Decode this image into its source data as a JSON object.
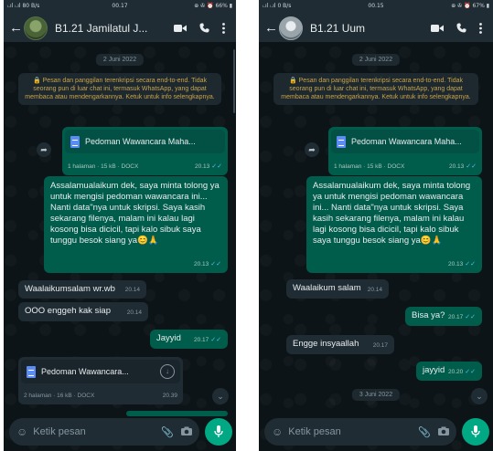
{
  "left": {
    "status": {
      "left": "ᵢ.ıl ᵢ.ıl 80 B/s",
      "time": "00.17",
      "right": "⊕ ✇ ⏰ 66% ▮"
    },
    "contact_name": "B1.21 Jamilatul J...",
    "date_chip": "2 Juni 2022",
    "encryption_notice": "🔒 Pesan dan panggilan terenkripsi secara end-to-end. Tidak seorang pun di luar chat ini, termasuk WhatsApp, yang dapat membaca atau mendengarkannya. Ketuk untuk info selengkapnya.",
    "doc_out": {
      "title": "Pedoman Wawancara Maha...",
      "meta": "1 halaman · 15 kB · DOCX",
      "time": "20.13"
    },
    "long_msg": {
      "text": "Assalamualaikum dek, saya minta tolong ya untuk mengisi pedoman wawancara ini... Nanti data\"nya untuk skripsi. Saya kasih sekarang filenya, malam ini kalau lagi kosong bisa dicicil, tapi kalo sibuk saya tunggu besok siang ya😊🙏",
      "time": "20.13"
    },
    "in_msgs": [
      {
        "text": "Waalaikumsalam wr.wb",
        "time": "20.14"
      },
      {
        "text": "OOO enggeh kak siap",
        "time": "20.14"
      }
    ],
    "out_short": {
      "text": "Jayyid",
      "time": "20.17"
    },
    "doc_in": {
      "title": "Pedoman Wawancara...",
      "meta": "2 halaman · 16 kB · DOCX",
      "time": "20.39"
    },
    "composer_placeholder": "Ketik pesan"
  },
  "right": {
    "status": {
      "left": "ᵢ.ıl ᵢ.ıl 0 B/s",
      "time": "00.15",
      "right": "⊕ ✇ ⏰ 67% ▮"
    },
    "contact_name": "B1.21 Uum",
    "date_chip": "2 Juni 2022",
    "encryption_notice": "🔒 Pesan dan panggilan terenkripsi secara end-to-end. Tidak seorang pun di luar chat ini, termasuk WhatsApp, yang dapat membaca atau mendengarkannya. Ketuk untuk info selengkapnya.",
    "doc_out": {
      "title": "Pedoman Wawancara Maha...",
      "meta": "1 halaman · 15 kB · DOCX",
      "time": "20.13"
    },
    "long_msg": {
      "text": "Assalamualaikum dek, saya minta tolong ya untuk mengisi pedoman wawancara ini... Nanti data\"nya untuk skripsi. Saya kasih sekarang filenya, malam ini kalau lagi kosong bisa dicicil, tapi kalo sibuk saya tunggu besok siang ya😊🙏",
      "time": "20.13"
    },
    "in_msg_1": {
      "text": "Waalaikum salam",
      "time": "20.14"
    },
    "out_msg_1": {
      "text": "Bisa ya?",
      "time": "20.17"
    },
    "in_msg_2": {
      "text": "Engge insyaallah",
      "time": "20.17"
    },
    "out_msg_2": {
      "text": "jayyid",
      "time": "20.20"
    },
    "date_chip_2": "3 Juni 2022",
    "composer_placeholder": "Ketik pesan"
  },
  "colors": {
    "outgoing": "#005c4b",
    "incoming": "#1f2c34",
    "header": "#1f2c34",
    "accent": "#00a884",
    "read_ticks": "#53bdeb"
  }
}
